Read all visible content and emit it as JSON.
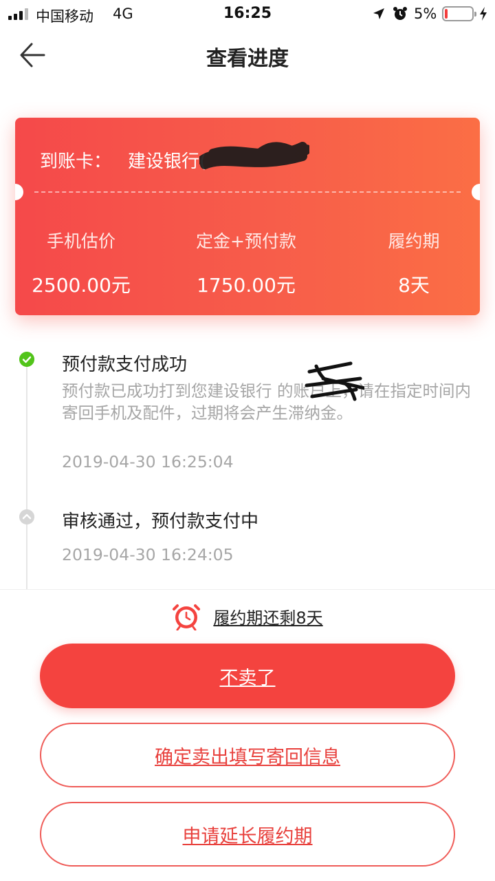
{
  "status_bar": {
    "carrier": "中国移动",
    "network": "4G",
    "time": "16:25",
    "battery_percent": "5%",
    "battery_level": 0.05
  },
  "nav": {
    "title": "查看进度",
    "back_icon": "arrow-left-icon"
  },
  "card": {
    "account_label": "到账卡：",
    "account_value": "建设银行(",
    "columns": [
      {
        "label": "手机估价",
        "value": "2500.00元"
      },
      {
        "label": "定金+预付款",
        "value": "1750.00元"
      },
      {
        "label": "履约期",
        "value": "8天"
      }
    ],
    "gradient_start": "#f5494a",
    "gradient_end": "#fb6e45"
  },
  "timeline": [
    {
      "status": "done",
      "title": "预付款支付成功",
      "description": "预付款已成功打到您建设银行        的账户上，请在指定时间内寄回手机及配件，过期将会产生滞纳金。",
      "time": "2019-04-30 16:25:04"
    },
    {
      "status": "pending",
      "title": "审核通过，预付款支付中",
      "time": "2019-04-30 16:24:05"
    }
  ],
  "bottom": {
    "remain_text": "履约期还剩8天",
    "clock_icon": "alarm-clock-icon",
    "buttons": {
      "cancel": "不卖了",
      "confirm": "确定卖出填写寄回信息",
      "extend": "申请延长履约期"
    }
  },
  "colors": {
    "accent": "#f4433f",
    "success": "#52c41a",
    "muted_text": "#a6a6a6"
  }
}
